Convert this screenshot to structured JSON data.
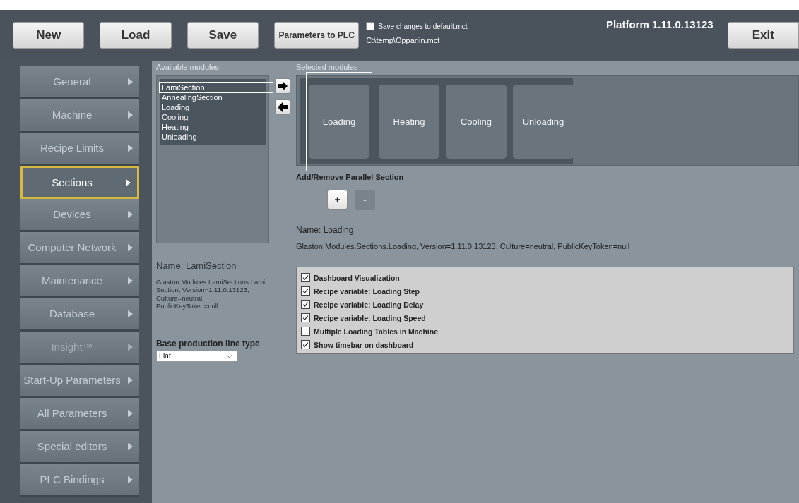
{
  "toolbar": {
    "buttons": [
      {
        "label": "New",
        "kind": "big"
      },
      {
        "label": "Load",
        "kind": "big"
      },
      {
        "label": "Save",
        "kind": "big"
      },
      {
        "label": "Parameters to PLC",
        "kind": "small"
      }
    ],
    "save_default": {
      "label": "Save changes to default.mct",
      "checked": false
    },
    "file_path": "C:\\temp\\Oppariin.mct",
    "platform": "Platform 1.11.0.13123",
    "exit": "Exit"
  },
  "sidebar": {
    "items": [
      {
        "label": "General",
        "selected": false,
        "disabled": false
      },
      {
        "label": "Machine",
        "selected": false,
        "disabled": false
      },
      {
        "label": "Recipe Limits",
        "selected": false,
        "disabled": false
      },
      {
        "label": "Sections",
        "selected": true,
        "disabled": false
      },
      {
        "label": "Devices",
        "selected": false,
        "disabled": false
      },
      {
        "label": "Computer Network",
        "selected": false,
        "disabled": false
      },
      {
        "label": "Maintenance",
        "selected": false,
        "disabled": false
      },
      {
        "label": "Database",
        "selected": false,
        "disabled": false
      },
      {
        "label": "Insight™",
        "selected": false,
        "disabled": true
      },
      {
        "label": "Start-Up Parameters",
        "selected": false,
        "disabled": false
      },
      {
        "label": "All Parameters",
        "selected": false,
        "disabled": false
      },
      {
        "label": "Special editors",
        "selected": false,
        "disabled": false
      },
      {
        "label": "PLC Bindings",
        "selected": false,
        "disabled": false
      }
    ]
  },
  "available": {
    "heading": "Available modules",
    "items": [
      {
        "label": "LamiSection",
        "selected": true
      },
      {
        "label": "AnnealingSection",
        "selected": false
      },
      {
        "label": "Loading",
        "selected": false
      },
      {
        "label": "Cooling",
        "selected": false
      },
      {
        "label": "Heating",
        "selected": false
      },
      {
        "label": "Unloading",
        "selected": false
      }
    ],
    "name": "Name: LamiSection",
    "description": "Glaston.Modules.LamiSections.LamiSection, Version=1.11.0.13123, Culture=neutral, PublicKeyToken=null",
    "base_label": "Base production line type",
    "base_value": "Flat"
  },
  "selected_modules": {
    "heading": "Selected modules",
    "items": [
      {
        "label": "Loading",
        "selected": true
      },
      {
        "label": "Heating",
        "selected": false
      },
      {
        "label": "Cooling",
        "selected": false
      },
      {
        "label": "Unloading",
        "selected": false
      }
    ],
    "parallel_label": "Add/Remove Parallel Section",
    "add": {
      "label": "+",
      "disabled": false
    },
    "remove": {
      "label": "-",
      "disabled": true
    },
    "name": "Name: Loading",
    "description": "Glaston.Modules.Sections.Loading, Version=1.11.0.13123, Culture=neutral, PublicKeyToken=null",
    "options": [
      {
        "label": "Dashboard Visualization",
        "checked": true
      },
      {
        "label": "Recipe variable: Loading Step",
        "checked": true
      },
      {
        "label": "Recipe variable: Loading Delay",
        "checked": true
      },
      {
        "label": "Recipe variable: Loading Speed",
        "checked": true
      },
      {
        "label": "Multiple Loading Tables in Machine",
        "checked": false
      },
      {
        "label": "Show timebar on dashboard",
        "checked": true
      }
    ]
  }
}
